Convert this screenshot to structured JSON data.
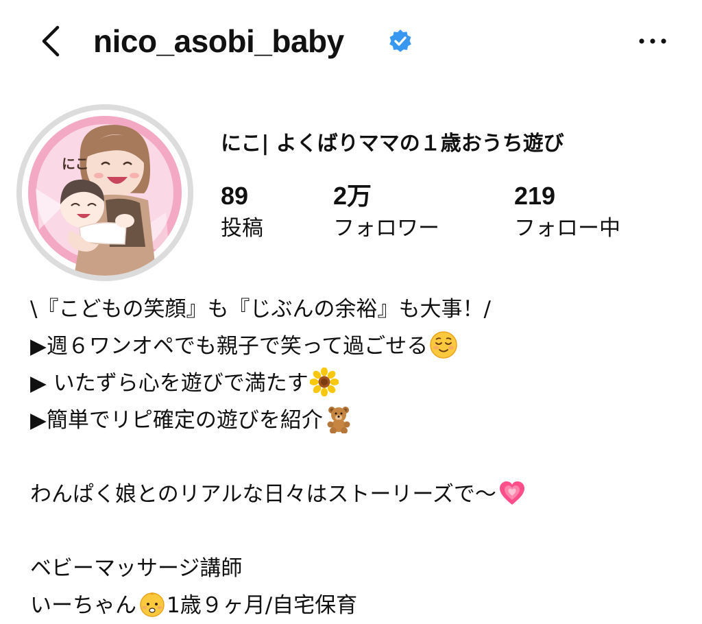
{
  "header": {
    "back_icon": "chevron-left-icon",
    "username": "nico_asobi_baby",
    "verified_icon": "verified-badge-icon",
    "more_icon": "more-horizontal-icon",
    "accent_color": "#3897f0"
  },
  "profile": {
    "display_name": "にこ| よくばりママの１歳おうち遊び",
    "avatar_icon": "illustrated-mother-and-baby-avatar",
    "avatar_text": "にこ",
    "stats": [
      {
        "value": "89",
        "label": "投稿"
      },
      {
        "value": "2万",
        "label": "フォロワー"
      },
      {
        "value": "219",
        "label": "フォロー中"
      }
    ]
  },
  "bio": {
    "lines": [
      {
        "text": "\\『こどもの笑顔』も『じぶんの余裕』も大事！/",
        "emoji": ""
      },
      {
        "text": "▶週６ワンオペでも親子で笑って過ごせる",
        "emoji": "relieved-face"
      },
      {
        "text": "▶ いたずら心を遊びで満たす",
        "emoji": "sunflower"
      },
      {
        "text": "▶簡単でリピ確定の遊びを紹介",
        "emoji": "teddy-bear"
      },
      {
        "text": "",
        "emoji": ""
      },
      {
        "text": "わんぱく娘とのリアルな日々はストーリーズで〜",
        "emoji": "growing-heart"
      },
      {
        "text": "",
        "emoji": ""
      },
      {
        "text": "ベビーマッサージ講師",
        "emoji": ""
      },
      {
        "text": "いーちゃん",
        "emoji": "baby"
      },
      {
        "text": "1歳９ヶ月/自宅保育",
        "emoji": ""
      }
    ]
  }
}
